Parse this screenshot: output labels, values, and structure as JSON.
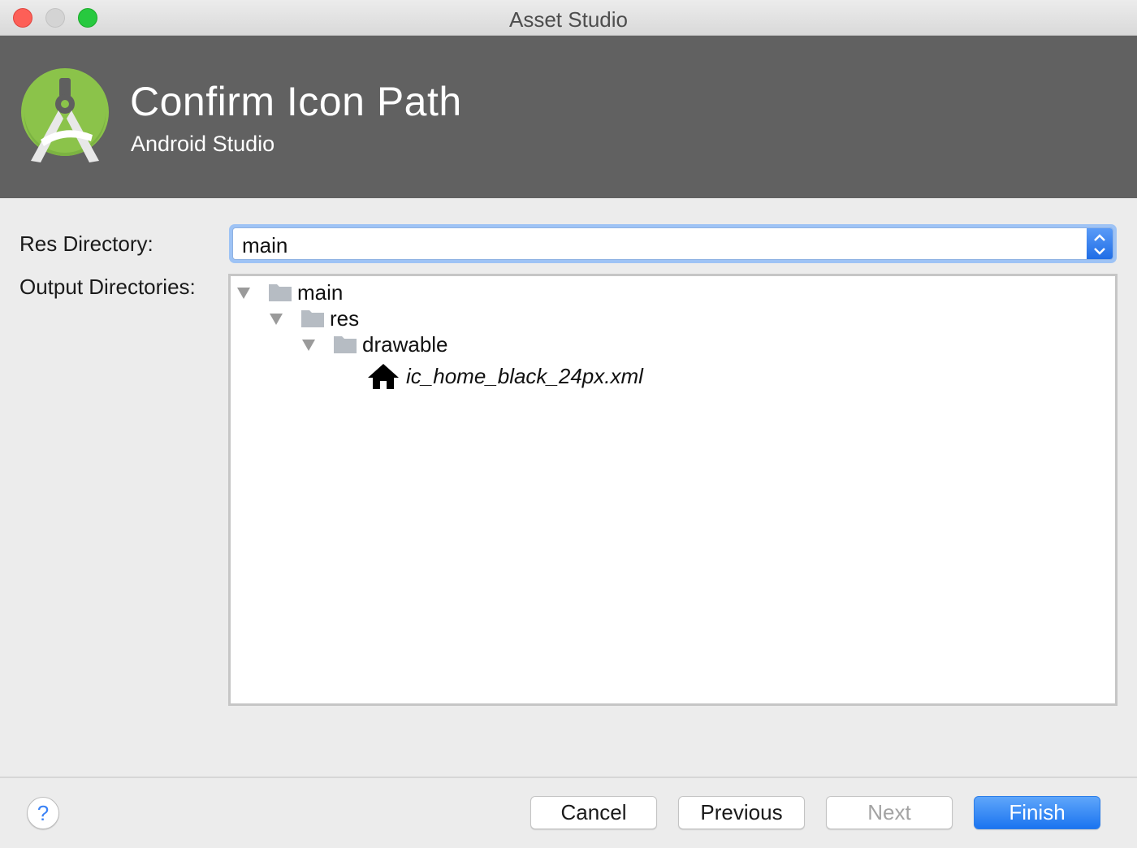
{
  "window": {
    "title": "Asset Studio"
  },
  "header": {
    "title": "Confirm Icon Path",
    "subtitle": "Android Studio",
    "logo_icon": "android-studio-logo-icon",
    "background": "#616161"
  },
  "form": {
    "res_directory_label": "Res Directory:",
    "res_directory_value": "main",
    "output_directories_label": "Output Directories:"
  },
  "tree": {
    "nodes": [
      {
        "label": "main",
        "icon": "folder-icon",
        "expanded": true
      },
      {
        "label": "res",
        "icon": "folder-icon",
        "expanded": true
      },
      {
        "label": "drawable",
        "icon": "folder-icon",
        "expanded": true
      },
      {
        "label": "ic_home_black_24px.xml",
        "icon": "home-icon"
      }
    ]
  },
  "footer": {
    "help_label": "?",
    "cancel_label": "Cancel",
    "previous_label": "Previous",
    "next_label": "Next",
    "finish_label": "Finish",
    "accent": "#1b74f0"
  }
}
